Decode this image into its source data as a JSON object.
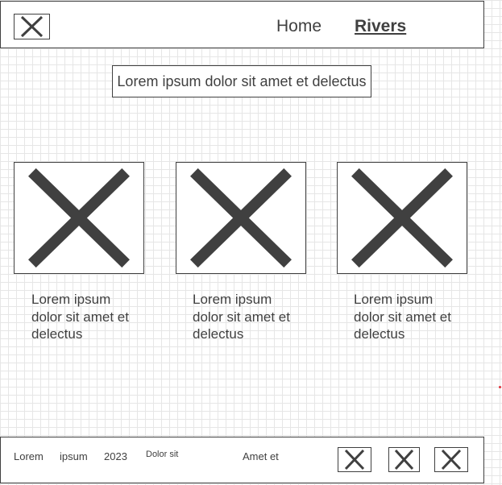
{
  "header": {
    "logo_icon": "close-x-icon",
    "nav": [
      {
        "label": "Home",
        "active": false
      },
      {
        "label": "Rivers",
        "active": true
      }
    ]
  },
  "main": {
    "headline": "Lorem ipsum dolor sit amet et delectus",
    "cards": [
      {
        "image_icon": "image-placeholder-icon",
        "text": "Lorem ipsum dolor sit amet et delectus"
      },
      {
        "image_icon": "image-placeholder-icon",
        "text": "Lorem ipsum dolor sit amet et delectus"
      },
      {
        "image_icon": "image-placeholder-icon",
        "text": "Lorem ipsum dolor sit amet et delectus"
      }
    ]
  },
  "footer": {
    "items": [
      "Lorem",
      "ipsum",
      "2023"
    ],
    "small": "Dolor sit",
    "extra": "Amet et",
    "icons": [
      "placeholder-icon",
      "placeholder-icon",
      "placeholder-icon"
    ]
  },
  "colors": {
    "stroke": "#404040",
    "grid": "#e6e6e6",
    "accent_dot": "#e0303a"
  }
}
